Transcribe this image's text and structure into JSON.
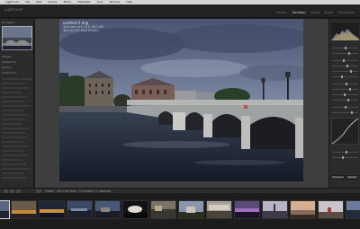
{
  "menubar": {
    "items": [
      "Lightroom",
      "File",
      "Edit",
      "Library",
      "Photo",
      "Metadata",
      "View",
      "Window",
      "Help"
    ]
  },
  "identity_plate": "Lightroom",
  "modules": [
    {
      "label": "Library",
      "active": false
    },
    {
      "label": "Develop",
      "active": true
    },
    {
      "label": "Maps",
      "active": false
    },
    {
      "label": "Book",
      "active": false
    },
    {
      "label": "Slideshow",
      "active": false
    }
  ],
  "photo": {
    "title": "untitled-5.dng",
    "line2": "1/30 sec at f / 8.0, ISO 100",
    "line3": "16 mm (EF-S10-22mm)"
  },
  "left_panel": {
    "labels": [
      "Navigator",
      "Presets",
      "Snapshots",
      "History",
      "Collections"
    ]
  },
  "right_panel": {
    "buttons": [
      "Previous",
      "Reset"
    ]
  },
  "toolbar": {
    "filmstrip_info": "Folder : 2011-06 Paris · 24 photos / 1 selected"
  },
  "colors": {
    "accent": "#dcdcdc",
    "panel_bg": "#2b2b2b",
    "workspace_bg": "#3e3e3e",
    "sky": "#5a6682"
  }
}
